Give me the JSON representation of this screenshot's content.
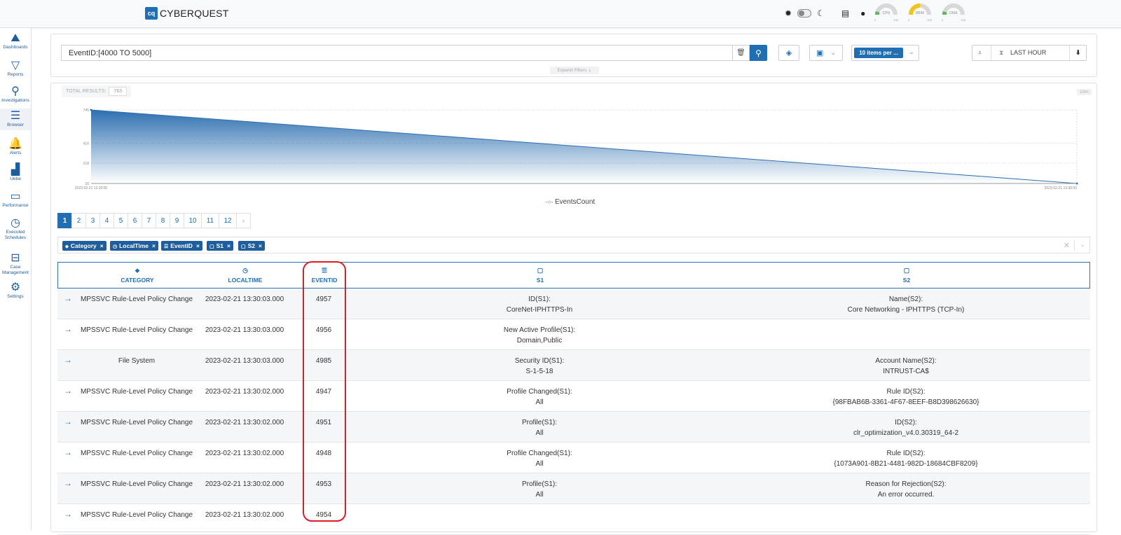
{
  "app": {
    "logo_mark": "cq",
    "logo_text": "CYBERQUEST"
  },
  "topbar": {
    "icons": [
      "sun-icon",
      "toggle",
      "moon-icon",
      "browser-window-icon",
      "user-icon"
    ],
    "gauges": [
      {
        "label": "CPU",
        "min": "0",
        "max": "100",
        "level": 0.1,
        "color": "#5cb85c"
      },
      {
        "label": "MEM",
        "min": "0",
        "max": "100",
        "level": 0.5,
        "color": "#f0c419"
      },
      {
        "label": "DISK",
        "min": "0",
        "max": "100",
        "level": 0.1,
        "color": "#5cb85c"
      }
    ]
  },
  "sidebar": {
    "items": [
      {
        "label": "Dashboards",
        "icon": "chart-area-icon",
        "glyph": "⛰"
      },
      {
        "label": "Reports",
        "icon": "filter-icon",
        "glyph": "▽"
      },
      {
        "label": "Investigations",
        "icon": "search-icon",
        "glyph": "⚲"
      },
      {
        "label": "Browser",
        "icon": "list-icon",
        "glyph": "☰"
      },
      {
        "label": "Alerts",
        "icon": "bell-icon",
        "glyph": "🔔"
      },
      {
        "label": "Ueba",
        "icon": "bar-chart-icon",
        "glyph": "▟"
      },
      {
        "label": "Performance",
        "icon": "memory-icon",
        "glyph": "▭"
      },
      {
        "label": "Executed Schedules",
        "icon": "clock-icon",
        "glyph": "◷"
      },
      {
        "label": "Case Management",
        "icon": "briefcase-icon",
        "glyph": "⊟"
      },
      {
        "label": "Settings",
        "icon": "gear-icon",
        "glyph": "⚙"
      }
    ],
    "active": "Browser"
  },
  "filter": {
    "query": "EventID:[4000 TO 5000]",
    "items_per_page": "10 items per ...",
    "time_range": "LAST HOUR",
    "expand_label": "Expand Filters"
  },
  "results": {
    "total_label": "TOTAL RESULTS:",
    "total_value": "763",
    "interval_label": "10m"
  },
  "chart_data": {
    "type": "area",
    "series": [
      {
        "name": "EventsCount",
        "x": [
          "2023-02-21 13:20:00",
          "2023-02-21 13:30:00"
        ],
        "values": [
          745,
          16
        ]
      }
    ],
    "yticks": [
      "16",
      "218",
      "416",
      "745"
    ],
    "xtick_labels": [
      "2023-02-21 13:20:00",
      "2023-02-21 13:30:00"
    ],
    "ylim": [
      16,
      745
    ],
    "grid": true,
    "legend": "bottom-center"
  },
  "pagination": {
    "pages": [
      "1",
      "2",
      "3",
      "4",
      "5",
      "6",
      "7",
      "8",
      "9",
      "10",
      "11",
      "12"
    ],
    "current": "1",
    "next": "›"
  },
  "tags": [
    {
      "label": "Category",
      "icon": "tag-icon",
      "glyph": "⬥"
    },
    {
      "label": "LocalTime",
      "icon": "clock-icon",
      "glyph": "◷"
    },
    {
      "label": "EventID",
      "icon": "ordered-list-icon",
      "glyph": "☰"
    },
    {
      "label": "S1",
      "icon": "comment-icon",
      "glyph": "▢"
    },
    {
      "label": "S2",
      "icon": "comment-icon",
      "glyph": "▢"
    }
  ],
  "table": {
    "columns": [
      {
        "label": "CATEGORY",
        "icon": "tag-icon",
        "glyph": "⬥"
      },
      {
        "label": "LOCALTIME",
        "icon": "clock-icon",
        "glyph": "◷"
      },
      {
        "label": "EVENTID",
        "icon": "ordered-list-icon",
        "glyph": "☰"
      },
      {
        "label": "S1",
        "icon": "comment-icon",
        "glyph": "▢"
      },
      {
        "label": "S2",
        "icon": "comment-icon",
        "glyph": "▢"
      }
    ],
    "rows": [
      {
        "category": "MPSSVC Rule-Level Policy Change",
        "localtime": "2023-02-21 13:30:03.000",
        "eventid": "4957",
        "s1_label": "ID(S1):",
        "s1_value": "CoreNet-IPHTTPS-In",
        "s2_label": "Name(S2):",
        "s2_value": "Core Networking - IPHTTPS (TCP-In)"
      },
      {
        "category": "MPSSVC Rule-Level Policy Change",
        "localtime": "2023-02-21 13:30:03.000",
        "eventid": "4956",
        "s1_label": "New Active Profile(S1):",
        "s1_value": "Domain,Public",
        "s2_label": "",
        "s2_value": ""
      },
      {
        "category": "File System",
        "localtime": "2023-02-21 13:30:03.000",
        "eventid": "4985",
        "s1_label": "Security ID(S1):",
        "s1_value": "S-1-5-18",
        "s2_label": "Account Name(S2):",
        "s2_value": "INTRUST-CA$"
      },
      {
        "category": "MPSSVC Rule-Level Policy Change",
        "localtime": "2023-02-21 13:30:02.000",
        "eventid": "4947",
        "s1_label": "Profile Changed(S1):",
        "s1_value": "All",
        "s2_label": "Rule ID(S2):",
        "s2_value": "{98FBAB6B-3361-4F67-8EEF-B8D398626630}"
      },
      {
        "category": "MPSSVC Rule-Level Policy Change",
        "localtime": "2023-02-21 13:30:02.000",
        "eventid": "4951",
        "s1_label": "Profile(S1):",
        "s1_value": "All",
        "s2_label": "ID(S2):",
        "s2_value": "clr_optimization_v4.0.30319_64-2"
      },
      {
        "category": "MPSSVC Rule-Level Policy Change",
        "localtime": "2023-02-21 13:30:02.000",
        "eventid": "4948",
        "s1_label": "Profile Changed(S1):",
        "s1_value": "All",
        "s2_label": "Rule ID(S2):",
        "s2_value": "{1073A901-8B21-4481-982D-18684CBF8209}"
      },
      {
        "category": "MPSSVC Rule-Level Policy Change",
        "localtime": "2023-02-21 13:30:02.000",
        "eventid": "4953",
        "s1_label": "Profile(S1):",
        "s1_value": "All",
        "s2_label": "Reason for Rejection(S2):",
        "s2_value": "An error occurred."
      },
      {
        "category": "MPSSVC Rule-Level Policy Change",
        "localtime": "2023-02-21 13:30:02.000",
        "eventid": "4954",
        "s1_label": "",
        "s1_value": "",
        "s2_label": "",
        "s2_value": ""
      }
    ]
  },
  "colors": {
    "accent": "#1f6fb2",
    "highlight": "#e01b24"
  }
}
